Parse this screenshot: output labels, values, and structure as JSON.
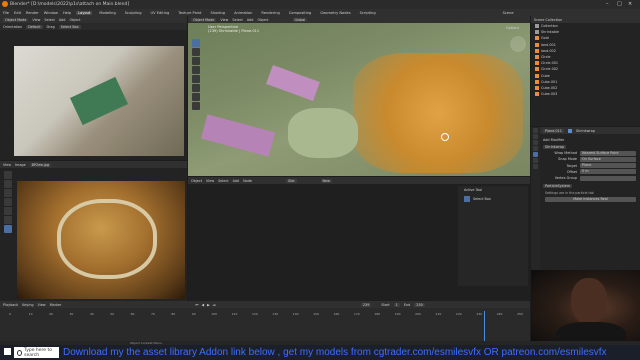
{
  "window": {
    "title": "Blender* [D:\\models\\2022\\p1s\\attach on Main.blend]",
    "workspace_label": "Scene"
  },
  "menu": {
    "items": [
      "File",
      "Edit",
      "Render",
      "Window",
      "Help"
    ],
    "workspaces": [
      "Layout",
      "Modeling",
      "Sculpting",
      "UV Editing",
      "Texture Paint",
      "Shading",
      "Animation",
      "Rendering",
      "Compositing",
      "Geometry Nodes",
      "Scripting"
    ],
    "active_workspace": "Layout"
  },
  "left_top_header": {
    "mode": "Object Mode",
    "items": [
      "View",
      "Select",
      "Add",
      "Object"
    ],
    "orientation_label": "Orientation",
    "orientation_value": "Default",
    "drag_label": "Drag",
    "drag_value": "Select Box"
  },
  "left_bottom_header": {
    "items": [
      "View",
      "Image"
    ],
    "image_name": "BP2ew.jpg"
  },
  "viewport": {
    "mode": "Object Mode",
    "items": [
      "View",
      "Select",
      "Add",
      "Object"
    ],
    "info_line1": "User Perspective",
    "info_line2": "(239) Shrinkable | Plane.011",
    "orientation_value": "Global",
    "drag_value": "Select Box",
    "options": "Options"
  },
  "node_editor": {
    "items": [
      "Object",
      "View",
      "Select",
      "Add",
      "Node"
    ],
    "slot": "Slot",
    "new_button": "New",
    "active_tool_label": "Active Tool",
    "select_box": "Select Box"
  },
  "outliner": {
    "header": "Scene Collection",
    "rows": [
      "Collection",
      "Shrinkable",
      "Gold",
      "land.001",
      "land.002",
      "Circle",
      "Circle.001",
      "Circle.002",
      "Cube",
      "Cube.001",
      "Cube.002",
      "Cube.003"
    ]
  },
  "properties": {
    "object_name": "Plane.011",
    "modifier_name": "Shrinkwrap",
    "add_modifier": "Add Modifier",
    "rows": [
      {
        "label": "Wrap Method",
        "value": "Nearest Surface Point"
      },
      {
        "label": "Snap Mode",
        "value": "On Surface"
      },
      {
        "label": "Target",
        "value": "Plane"
      },
      {
        "label": "Offset",
        "value": "0 m"
      },
      {
        "label": "Vertex Group",
        "value": ""
      }
    ],
    "particles_label": "ParticleSystem",
    "settings_note": "Settings are in the particle tab",
    "convert_button": "Make Instances Real"
  },
  "timeline": {
    "items": [
      "Playback",
      "Keying",
      "View",
      "Marker"
    ],
    "current_frame": "239",
    "start_label": "Start",
    "start_value": "1",
    "end_label": "End",
    "end_value": "250",
    "ticks": [
      "0",
      "10",
      "20",
      "30",
      "40",
      "50",
      "60",
      "70",
      "80",
      "90",
      "100",
      "110",
      "120",
      "130",
      "140",
      "150",
      "160",
      "170",
      "180",
      "190",
      "200",
      "210",
      "220",
      "230",
      "240",
      "250"
    ]
  },
  "statusbar": {
    "text": "Object Context Menu"
  },
  "taskbar": {
    "search_placeholder": "Type here to search",
    "banner": "Download my the asset library Addon  link below ,  get my models from cgtrader.com/esmilesvfx OR patreon.com/esmilesvfx"
  }
}
